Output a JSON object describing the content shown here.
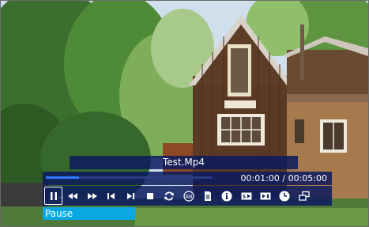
{
  "player": {
    "title": "Test.Mp4",
    "time_display": "00:01:00 / 00:05:00",
    "progress": 0.2,
    "tooltip": "Pause"
  },
  "controls": [
    {
      "name": "pause-icon",
      "active": true
    },
    {
      "name": "rewind-icon"
    },
    {
      "name": "fast-forward-icon"
    },
    {
      "name": "previous-track-icon"
    },
    {
      "name": "next-track-icon"
    },
    {
      "name": "stop-icon"
    },
    {
      "name": "repeat-icon"
    },
    {
      "name": "ab-repeat-icon"
    },
    {
      "name": "playlist-icon"
    },
    {
      "name": "info-icon"
    },
    {
      "name": "slideshow-icon"
    },
    {
      "name": "subtitle-icon"
    },
    {
      "name": "sleep-timer-icon"
    },
    {
      "name": "window-mode-icon"
    }
  ],
  "colors": {
    "osd_background": "#0a1a5f",
    "progress_fill": "#2f7cff",
    "tooltip_background": "#08a8e0"
  }
}
